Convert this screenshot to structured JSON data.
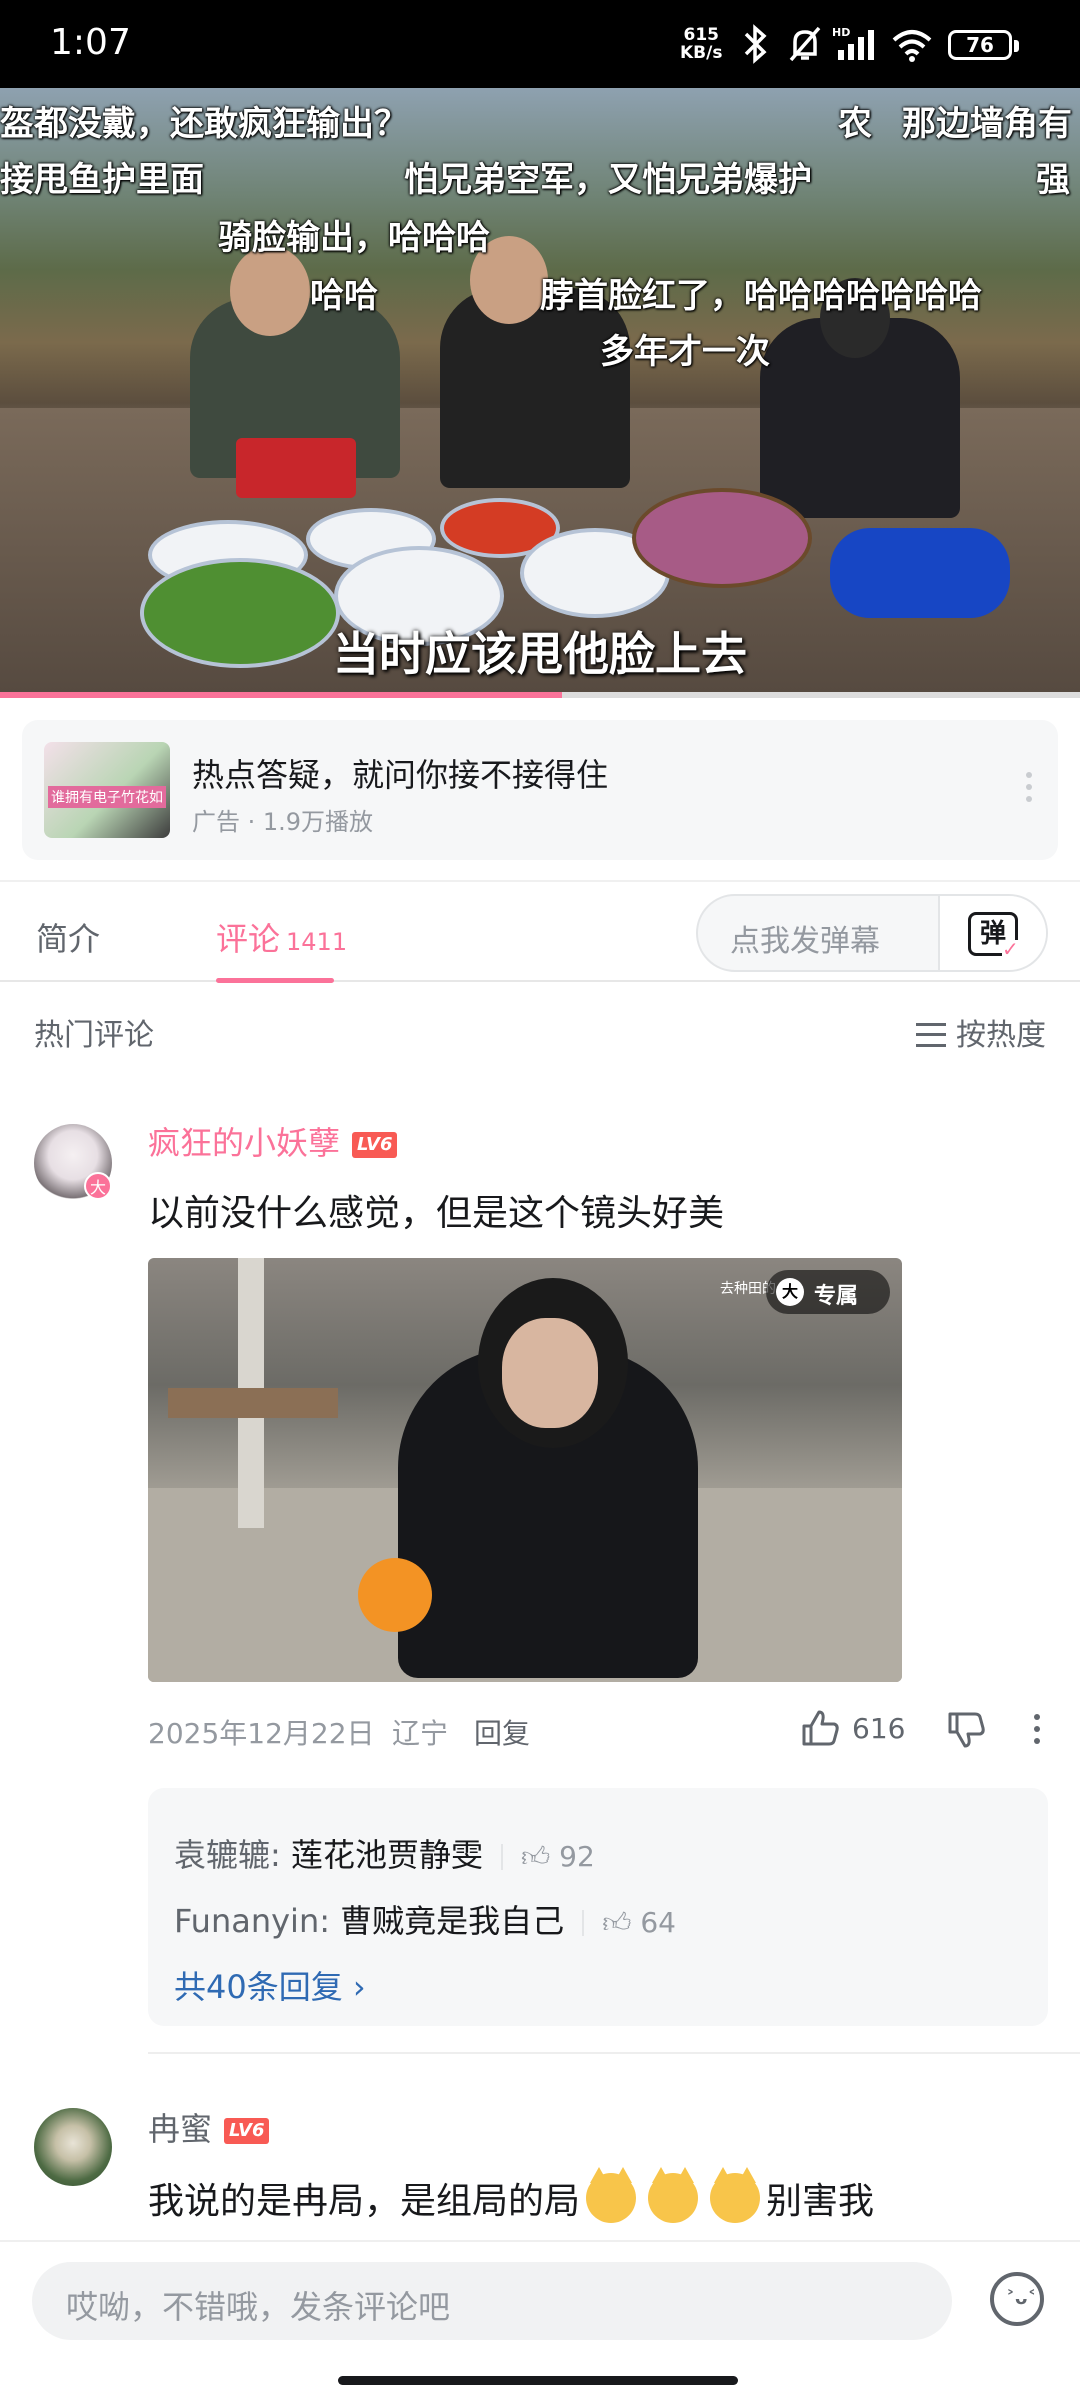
{
  "status_bar": {
    "time": "1:07",
    "net_speed_value": "615",
    "net_speed_unit": "KB/s",
    "battery": "76"
  },
  "video": {
    "danmaku": [
      "盔都没戴，还敢疯狂输出？",
      "农",
      "那边墙角有",
      "接甩鱼护里面",
      "怕兄弟空军，又怕兄弟爆护",
      "强",
      "骑脸输出，哈哈哈",
      "哈哈",
      "脖首脸红了，哈哈哈哈哈哈哈",
      "多年才一次"
    ],
    "subtitle": "当时应该甩他脸上去",
    "progress_fraction": 0.52
  },
  "ad": {
    "thumb_text": "谁拥有电子竹花如",
    "title": "热点答疑，就问你接不接得住",
    "subtitle": "广告 · 1.9万播放"
  },
  "tabs": {
    "intro": "简介",
    "comments": "评论",
    "comments_count": "1411",
    "danmu_placeholder": "点我发弹幕",
    "danmu_button": "弹"
  },
  "hot_header": {
    "label": "热门评论",
    "sort": "按热度"
  },
  "comments": [
    {
      "username": "疯狂的小妖孽",
      "level": "LV6",
      "avatar_badge": "大",
      "text": "以前没什么感觉，但是这个镜头好美",
      "image_watermark": "去种田的",
      "image_badge_icon": "大",
      "image_badge": "专属",
      "date": "2025年12月22日",
      "location": "辽宁",
      "reply_label": "回复",
      "likes": "616",
      "replies": [
        {
          "user": "袁辘辘:",
          "text": "莲花池贾静雯",
          "likes": "92"
        },
        {
          "user": "Funanyin:",
          "text": "曹贼竟是我自己",
          "likes": "64"
        }
      ],
      "all_replies": "共40条回复"
    },
    {
      "username": "冉蜜",
      "level": "LV6",
      "text_before_emoji": "我说的是冉局，是组局的局",
      "text_after_emoji": "别害我",
      "emoji_count": 3
    }
  ],
  "bottom_bar": {
    "placeholder": "哎呦，不错哦，发条评论吧"
  },
  "colors": {
    "accent": "#fb7299",
    "level_badge": "#f85a54",
    "link": "#2f6ab3"
  }
}
